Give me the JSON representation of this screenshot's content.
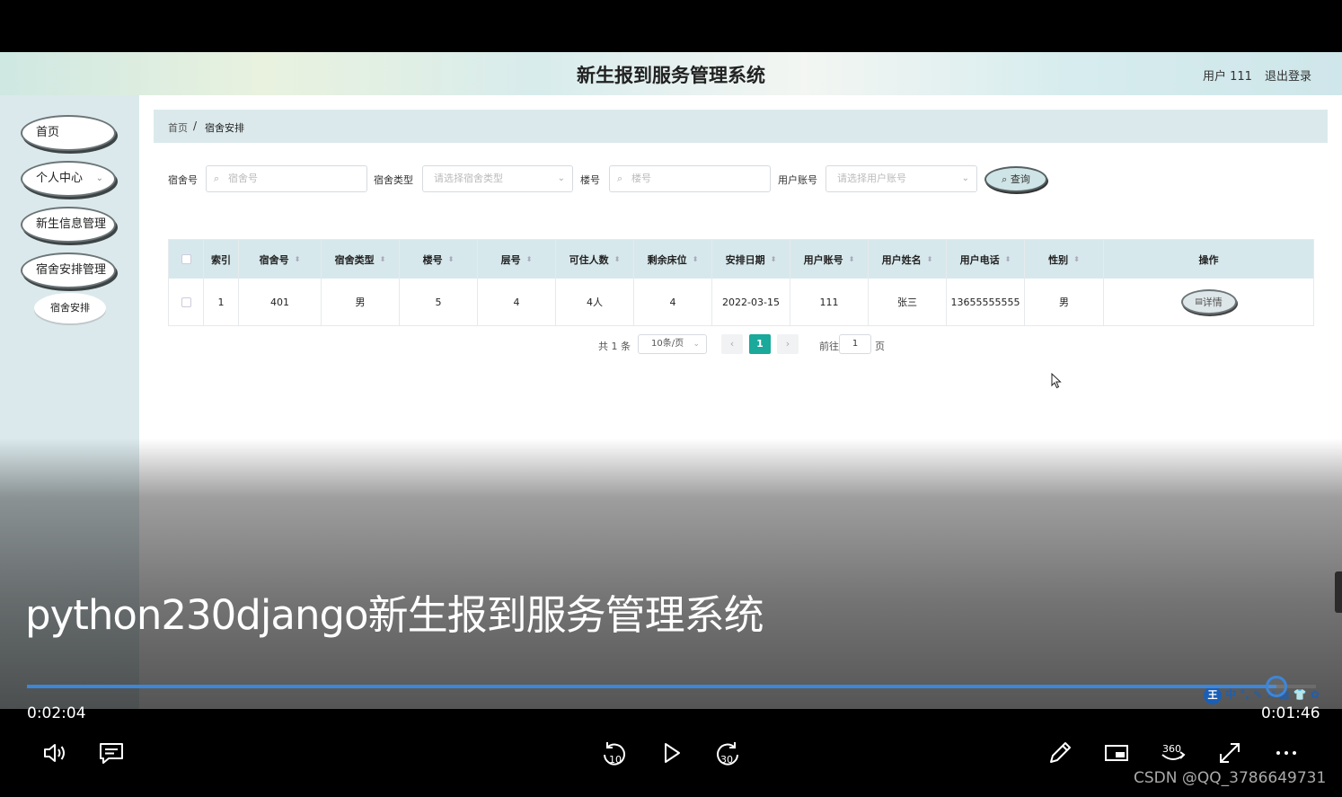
{
  "app": {
    "title": "新生报到服务管理系统",
    "user_label": "用户 111",
    "logout": "退出登录"
  },
  "sidebar": {
    "items": [
      {
        "label": "首页"
      },
      {
        "label": "个人中心"
      },
      {
        "label": "新生信息管理"
      },
      {
        "label": "宿舍安排管理"
      }
    ],
    "subitem": {
      "label": "宿舍安排"
    }
  },
  "breadcrumb": {
    "home": "首页",
    "separator": "/",
    "current": "宿舍安排"
  },
  "filters": {
    "dorm_no": {
      "label": "宿舍号",
      "placeholder": "宿舍号"
    },
    "dorm_type": {
      "label": "宿舍类型",
      "placeholder": "请选择宿舍类型"
    },
    "building": {
      "label": "楼号",
      "placeholder": "楼号"
    },
    "account": {
      "label": "用户账号",
      "placeholder": "请选择用户账号"
    },
    "search_button": "查询"
  },
  "table": {
    "columns": [
      "",
      "索引",
      "宿舍号",
      "宿舍类型",
      "楼号",
      "层号",
      "可住人数",
      "剩余床位",
      "安排日期",
      "用户账号",
      "用户姓名",
      "用户电话",
      "性别",
      "操作"
    ],
    "rows": [
      [
        "",
        "1",
        "401",
        "男",
        "5",
        "4",
        "4人",
        "4",
        "2022-03-15",
        "111",
        "张三",
        "13655555555",
        "男",
        "详情"
      ]
    ]
  },
  "pagination": {
    "total": "共 1 条",
    "page_size": "10条/页",
    "prev": "‹",
    "current": "1",
    "next": "›",
    "goto_label": "前往",
    "goto_value": "1",
    "goto_suffix": "页"
  },
  "video": {
    "title": "python230django新生报到服务管理系统",
    "elapsed": "0:02:04",
    "remaining": "0:01:46",
    "progress_fraction": 0.969,
    "watermark": "CSDN @QQ_3786649731",
    "ime_chars": "王 中 °, ✎ ⚒ ▦ 👕 ✿"
  },
  "colors": {
    "accent": "#3d86d8",
    "table_header": "#d7e8ec",
    "pager_active": "#1aa99b",
    "sidebar_bg": "#dbe9ec"
  },
  "icons": [
    "volume-icon",
    "subtitles-icon",
    "rewind-10-icon",
    "play-icon",
    "forward-30-icon",
    "pen-icon",
    "miniplayer-icon",
    "view-360-icon",
    "fullscreen-icon",
    "more-icon"
  ]
}
